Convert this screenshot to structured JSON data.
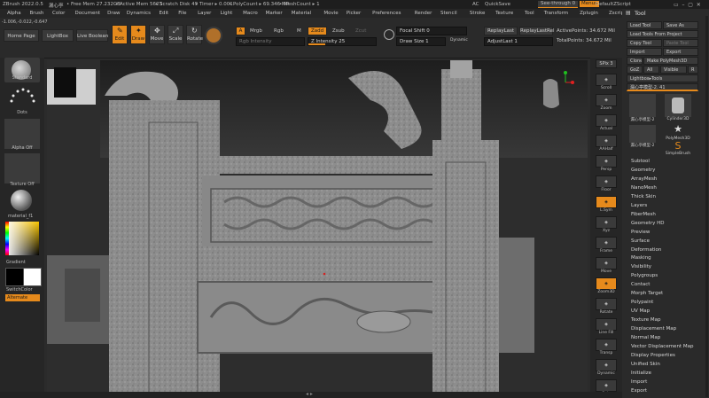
{
  "titlebar": {
    "app": "ZBrush 2022.0.5",
    "doc": "漏心亭",
    "free_mem": "• Free Mem 27.232GB",
    "active_mem": "• Active Mem 5623",
    "scratch": "• Scratch Disk 49",
    "timer": "• Timer ▸ 0.001",
    "polycount": "• PolyCount ▸ 69.346 MP",
    "meshcount": "• MeshCount ▸ 1",
    "ac": "AC",
    "quicksave": "QuickSave",
    "see_through": "See-through  0",
    "menus": "Menus",
    "script": "DefaultZScript"
  },
  "menubar": [
    "Alpha",
    "Brush",
    "Color",
    "Document",
    "Draw",
    "Dynamics",
    "Edit",
    "File",
    "Layer",
    "Light",
    "Macro",
    "Marker",
    "Material",
    "Movie",
    "Picker",
    "Preferences",
    "Render",
    "Stencil",
    "Stroke",
    "Texture",
    "Tool",
    "Transform",
    "Zplugin",
    "Zscript",
    "Help"
  ],
  "toolbar": {
    "home_page": "Home Page",
    "lightbox": "LightBox",
    "live_boolean": "Live Boolean",
    "edit": "Edit",
    "draw": "Draw",
    "move": "Move",
    "scale": "Scale",
    "rotate": "Rotate",
    "a": "A",
    "mrgb": "Mrgb",
    "rgb": "Rgb",
    "m": "M",
    "rgb_intensity": "Rgb Intensity",
    "zadd": "Zadd",
    "zsub": "Zsub",
    "zcut": "Zcut",
    "z_intensity": "Z Intensity 25",
    "focal_shift": "Focal Shift 0",
    "draw_size": "Draw Size 1",
    "dynamic": "Dynamic",
    "replay_last": "ReplayLast",
    "replay_last_rel": "ReplayLastRel",
    "adjust_last": "AdjustLast 1",
    "active_points": "ActivePoints: 34.672 Mil",
    "total_points": "TotalPoints: 34.672 Mil"
  },
  "progress": {
    "z_intensity": 0.25,
    "rgb_intensity": 0.0
  },
  "coords": "-1.006,-0.022,-0.647",
  "left": {
    "brush": "Standard",
    "stroke": "Dots",
    "alpha": "Alpha Off",
    "texture": "Texture Off",
    "material": "material_f1",
    "gradient": "Gradient",
    "switch_color": "SwitchColor",
    "alternate": "Alternate"
  },
  "rightbar": {
    "spix": "SPix 3",
    "labels": [
      "Scroll",
      "Zoom",
      "Actual",
      "AAHalf",
      "Persp",
      "Floor",
      "L.Sym",
      "Xyz",
      "Frame",
      "Move",
      "Zoom3D",
      "Rotate",
      "Line Fill",
      "Transp",
      "Dynamic",
      "Solo"
    ]
  },
  "tool": {
    "header": "Tool",
    "load_tool": "Load Tool",
    "save_as": "Save As",
    "load_tools_from_project": "Load Tools From Project",
    "copy_tool": "Copy Tool",
    "paste_tool": "Paste Tool",
    "import": "Import",
    "export": "Export",
    "clone": "Clone",
    "make_polymesh": "Make PolyMesh3D",
    "goz": "GoZ",
    "all": "All",
    "visible": "Visible",
    "r": "R",
    "lightbox_tools": "Lightbox▸Tools",
    "current_tool": "漏心亭模型-2. 41",
    "thumbs": [
      "漏心亭模型-2",
      "Cylinder3D",
      "PolyMesh3D",
      "漏心亭模型-2",
      "SimpleBrush"
    ],
    "sections": [
      "Subtool",
      "Geometry",
      "ArrayMesh",
      "NanoMesh",
      "Thick Skin",
      "Layers",
      "FiberMesh",
      "Geometry HD",
      "Preview",
      "Surface",
      "Deformation",
      "Masking",
      "Visibility",
      "Polygroups",
      "Contact",
      "Morph Target",
      "Polypaint",
      "UV Map",
      "Texture Map",
      "Displacement Map",
      "Normal Map",
      "Vector Displacement Map",
      "Display Properties",
      "Unified Skin",
      "Initialize",
      "Import",
      "Export"
    ]
  },
  "colors": {
    "accent": "#e68a1c",
    "panel": "#2a2a2a",
    "canvas": "#333333"
  }
}
